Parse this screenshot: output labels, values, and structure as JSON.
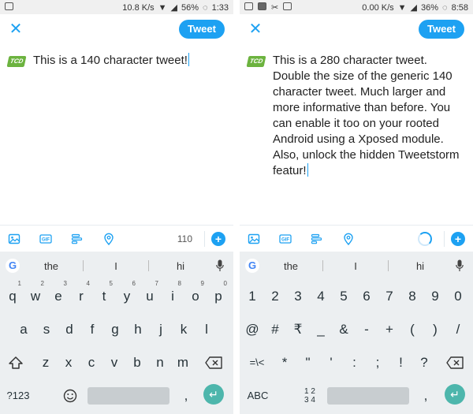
{
  "left": {
    "status": {
      "speed": "10.8 K/s",
      "battery": "56%",
      "time": "1:33"
    },
    "tweet_label": "Tweet",
    "tweet_text": "This is a 140 character tweet!",
    "counter": "110",
    "suggestions": [
      "the",
      "I",
      "hi"
    ],
    "rows": [
      [
        [
          "q",
          "1"
        ],
        [
          "w",
          "2"
        ],
        [
          "e",
          "3"
        ],
        [
          "r",
          "4"
        ],
        [
          "t",
          "5"
        ],
        [
          "y",
          "6"
        ],
        [
          "u",
          "7"
        ],
        [
          "i",
          "8"
        ],
        [
          "o",
          "9"
        ],
        [
          "p",
          "0"
        ]
      ],
      [
        [
          "a",
          ""
        ],
        [
          "s",
          ""
        ],
        [
          "d",
          ""
        ],
        [
          "f",
          ""
        ],
        [
          "g",
          ""
        ],
        [
          "h",
          ""
        ],
        [
          "j",
          ""
        ],
        [
          "k",
          ""
        ],
        [
          "l",
          ""
        ]
      ],
      [
        [
          "z",
          ""
        ],
        [
          "x",
          ""
        ],
        [
          "c",
          ""
        ],
        [
          "v",
          ""
        ],
        [
          "b",
          ""
        ],
        [
          "n",
          ""
        ],
        [
          "m",
          ""
        ]
      ]
    ],
    "fn_left": "?123",
    "fn_comma": ","
  },
  "right": {
    "status": {
      "speed": "0.00 K/s",
      "battery": "36%",
      "time": "8:58"
    },
    "tweet_label": "Tweet",
    "tweet_text": "This is a 280 character tweet. Double the size of the generic 140 character tweet. Much larger and more informative than before. You can enable it too on your rooted Android using a Xposed module. Also, unlock the hidden Tweetstorm featur!",
    "suggestions": [
      "the",
      "I",
      "hi"
    ],
    "rows": [
      [
        "1",
        "2",
        "3",
        "4",
        "5",
        "6",
        "7",
        "8",
        "9",
        "0"
      ],
      [
        "@",
        "#",
        "₹",
        "_",
        "&",
        "-",
        "+",
        "(",
        ")",
        "/"
      ],
      [
        "*",
        "\"",
        "'",
        ":",
        ";",
        "!",
        "?"
      ]
    ],
    "fn_symbols": "=\\<",
    "fn_left": "ABC",
    "fn_numpad": "1 2\n3 4",
    "fn_comma": ","
  },
  "colors": {
    "accent": "#1da1f2",
    "enter": "#4db6ac",
    "keyboard_bg": "#eceff1",
    "avatar": "#6cb33f"
  },
  "avatar_text": "TCD",
  "icons": [
    "close-icon",
    "image-icon",
    "gif-icon",
    "poll-icon",
    "location-icon",
    "add-icon",
    "google-icon",
    "mic-icon",
    "shift-icon",
    "backspace-icon",
    "emoji-icon",
    "enter-icon"
  ]
}
